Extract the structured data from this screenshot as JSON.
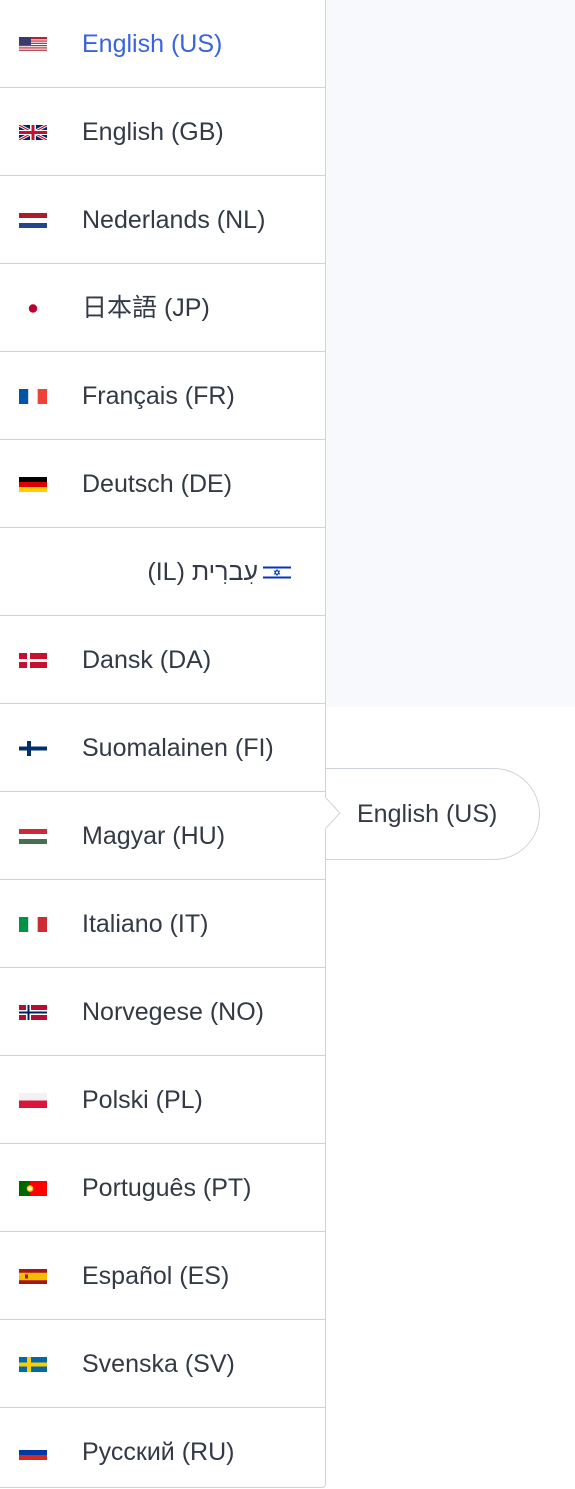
{
  "languages": [
    {
      "label": "English (US)",
      "flag": "us-flag-icon",
      "active": true
    },
    {
      "label": "English (GB)",
      "flag": "gb-flag-icon"
    },
    {
      "label": "Nederlands (NL)",
      "flag": "nl-flag-icon"
    },
    {
      "label": "日本語 (JP)",
      "flag": "jp-flag-icon"
    },
    {
      "label": "Français (FR)",
      "flag": "fr-flag-icon"
    },
    {
      "label": "Deutsch (DE)",
      "flag": "de-flag-icon"
    },
    {
      "label": "עִברִית (IL)",
      "flag": "il-flag-icon",
      "rtl": true
    },
    {
      "label": "Dansk (DA)",
      "flag": "dk-flag-icon"
    },
    {
      "label": "Suomalainen (FI)",
      "flag": "fi-flag-icon"
    },
    {
      "label": "Magyar (HU)",
      "flag": "hu-flag-icon"
    },
    {
      "label": "Italiano (IT)",
      "flag": "it-flag-icon"
    },
    {
      "label": "Norvegese (NO)",
      "flag": "no-flag-icon"
    },
    {
      "label": "Polski (PL)",
      "flag": "pl-flag-icon"
    },
    {
      "label": "Português (PT)",
      "flag": "pt-flag-icon"
    },
    {
      "label": "Español (ES)",
      "flag": "es-flag-icon"
    },
    {
      "label": "Svenska (SV)",
      "flag": "se-flag-icon"
    },
    {
      "label": "Русский (RU)",
      "flag": "ru-flag-icon"
    }
  ],
  "selector": {
    "current_label": "English (US)"
  },
  "colors": {
    "active_text": "#3a63e0",
    "text": "#333a46",
    "border": "#cfd4db",
    "panel_bg": "#f7f9fd"
  }
}
